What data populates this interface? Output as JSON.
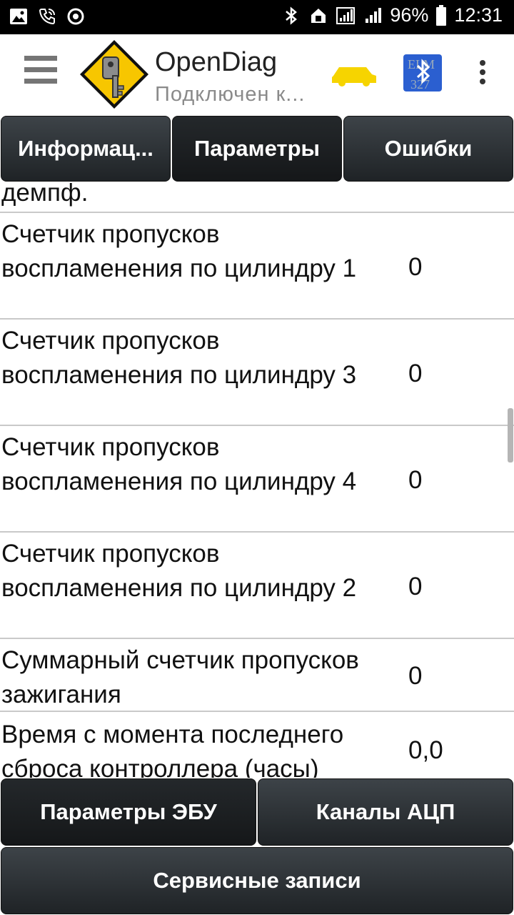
{
  "status_bar": {
    "battery": "96%",
    "time": "12:31",
    "icons": [
      "image-icon",
      "wifi-call-icon",
      "sync-icon",
      "bluetooth-icon",
      "nfc-icon",
      "signal-icon",
      "signal-icon",
      "battery-icon"
    ]
  },
  "app_bar": {
    "title": "OpenDiag",
    "subtitle": "Подключен к...",
    "icons": [
      "menu-icon",
      "app-logo-key",
      "car-icon",
      "bluetooth-elm327-icon",
      "overflow-menu-icon"
    ],
    "car_color": "#f6d400",
    "bt_color": "#2b5fd0"
  },
  "tabs": [
    {
      "label": "Информац...",
      "active": false
    },
    {
      "label": "Параметры",
      "active": true
    },
    {
      "label": "Ошибки",
      "active": false
    }
  ],
  "parameters": [
    {
      "name": "демпф.",
      "value": ""
    },
    {
      "name": "Счетчик пропусков воспламенения по цилиндру 1",
      "value": "0"
    },
    {
      "name": "Счетчик пропусков воспламенения по цилиндру 3",
      "value": "0"
    },
    {
      "name": "Счетчик пропусков воспламенения по цилиндру 4",
      "value": "0"
    },
    {
      "name": "Счетчик пропусков воспламенения по цилиндру 2",
      "value": "0"
    },
    {
      "name": "Суммарный счетчик пропусков зажигания",
      "value": "0"
    },
    {
      "name": "Время с момента последнего сброса контроллера (часы)",
      "value": "0,0"
    }
  ],
  "bottom_buttons": {
    "ecu_params": "Параметры ЭБУ",
    "adc_channels": "Каналы АЦП",
    "service_records": "Сервисные записи"
  }
}
